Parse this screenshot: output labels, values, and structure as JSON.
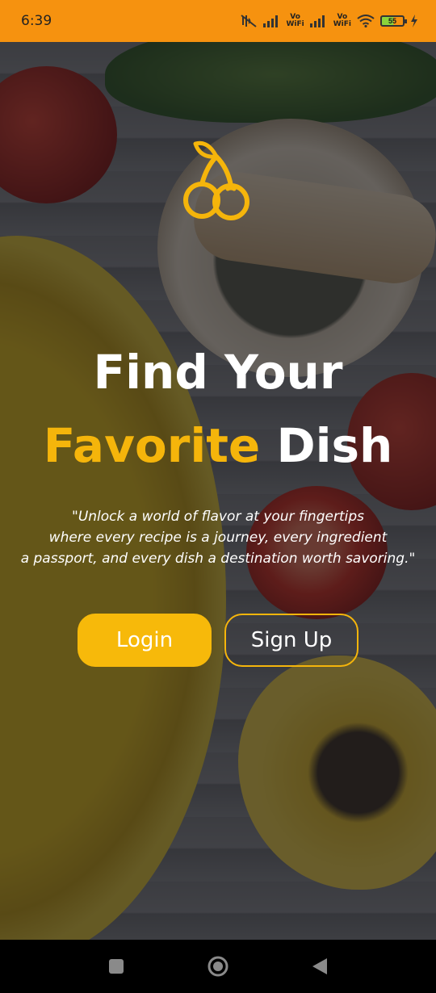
{
  "status_bar": {
    "time": "6:39",
    "wifi_label_1": "Vo\nWiFi",
    "wifi_label_2": "Vo\nWiFi",
    "battery": "55",
    "background_color": "#f6920f"
  },
  "hero": {
    "title_line1": "Find Your",
    "title_line2_accent": "Favorite",
    "title_line2_rest": " Dish",
    "quote_line1": "\"Unlock a world of flavor at your fingertips",
    "quote_line2": "where every recipe is a journey, every ingredient",
    "quote_line3": "a passport, and every dish a destination worth savoring.\""
  },
  "actions": {
    "login_label": "Login",
    "signup_label": "Sign Up"
  },
  "icons": {
    "logo": "cherry-icon",
    "nav_recents": "square-icon",
    "nav_home": "circle-icon",
    "nav_back": "triangle-back-icon"
  },
  "colors": {
    "accent": "#f5b50b",
    "button_fill": "#f7b90a",
    "text": "#ffffff"
  }
}
